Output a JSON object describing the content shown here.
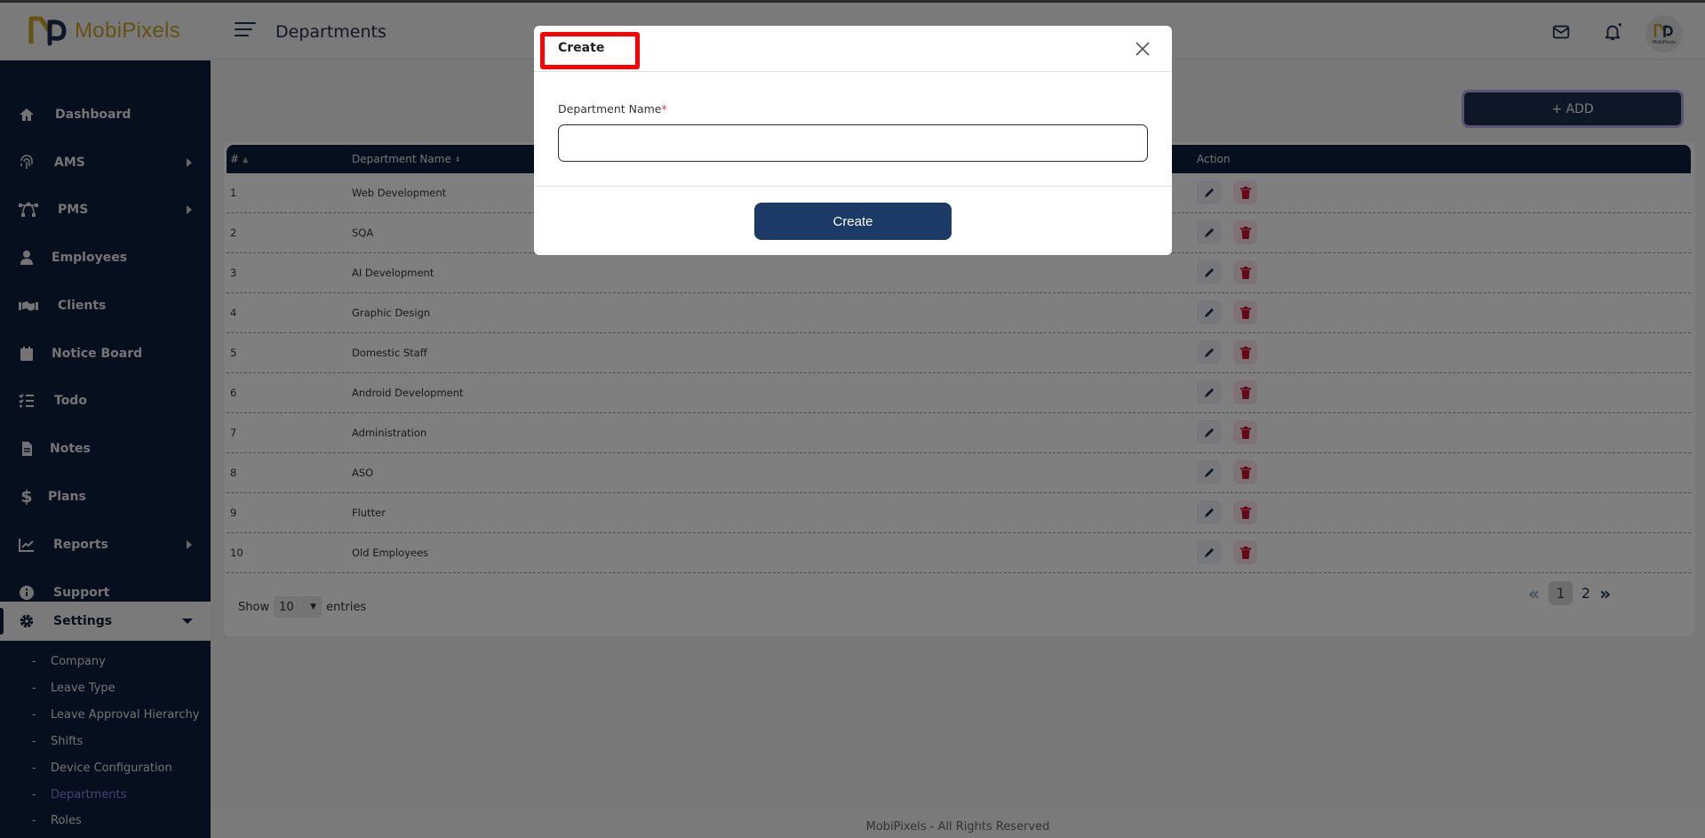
{
  "header": {
    "brand": "MobiPixels",
    "page_title": "Departments",
    "avatar_text": "MobiPixels",
    "icons": [
      "menu-icon",
      "mail-icon",
      "bell-icon"
    ]
  },
  "sidebar": {
    "items": [
      {
        "label": "Dashboard",
        "icon": "home-icon",
        "has_children": false
      },
      {
        "label": "AMS",
        "icon": "fingerprint-icon",
        "has_children": true
      },
      {
        "label": "PMS",
        "icon": "bezier-icon",
        "has_children": true
      },
      {
        "label": "Employees",
        "icon": "user-icon",
        "has_children": false
      },
      {
        "label": "Clients",
        "icon": "handshake-icon",
        "has_children": false
      },
      {
        "label": "Notice Board",
        "icon": "calendar-icon",
        "has_children": false
      },
      {
        "label": "Todo",
        "icon": "list-check-icon",
        "has_children": false
      },
      {
        "label": "Notes",
        "icon": "file-icon",
        "has_children": false
      },
      {
        "label": "Plans",
        "icon": "dollar-icon",
        "has_children": false
      },
      {
        "label": "Reports",
        "icon": "chart-line-icon",
        "has_children": true
      },
      {
        "label": "Support",
        "icon": "info-icon",
        "has_children": false
      },
      {
        "label": "Settings",
        "icon": "gear-icon",
        "has_children": true,
        "expanded": true
      }
    ],
    "settings_subitems": [
      {
        "label": "Company"
      },
      {
        "label": "Leave Type"
      },
      {
        "label": "Leave Approval Hierarchy"
      },
      {
        "label": "Shifts"
      },
      {
        "label": "Device Configuration"
      },
      {
        "label": "Departments",
        "current": true
      },
      {
        "label": "Roles"
      }
    ]
  },
  "main": {
    "add_button": "+ ADD",
    "table": {
      "columns": [
        {
          "label": "#",
          "sort": "asc"
        },
        {
          "label": "Department Name",
          "sort": "both"
        },
        {
          "label": "Action"
        }
      ],
      "rows": [
        {
          "num": "1",
          "name": "Web Development"
        },
        {
          "num": "2",
          "name": "SQA"
        },
        {
          "num": "3",
          "name": "AI Development"
        },
        {
          "num": "4",
          "name": "Graphic Design"
        },
        {
          "num": "5",
          "name": "Domestic Staff"
        },
        {
          "num": "6",
          "name": "Android Development"
        },
        {
          "num": "7",
          "name": "Administration"
        },
        {
          "num": "8",
          "name": "ASO"
        },
        {
          "num": "9",
          "name": "Flutter"
        },
        {
          "num": "10",
          "name": "Old Employees"
        }
      ]
    },
    "show_label": "Show",
    "entries_value": "10",
    "entries_label": "entries",
    "pagination": {
      "pages": [
        "1",
        "2"
      ],
      "current": "1",
      "prev": "«",
      "next": "»"
    }
  },
  "footer": {
    "text": "MobiPixels - All Rights Reserved"
  },
  "modal": {
    "title": "Create",
    "field_label": "Department Name",
    "required_mark": "*",
    "field_value": "",
    "field_placeholder": "",
    "submit_label": "Create"
  },
  "colors": {
    "primary": "#1b2f50",
    "sidebar_bg": "#0b1e3a",
    "brand_gold": "#c9a227",
    "danger": "#d0142c",
    "highlight_box": "#ff0000"
  }
}
